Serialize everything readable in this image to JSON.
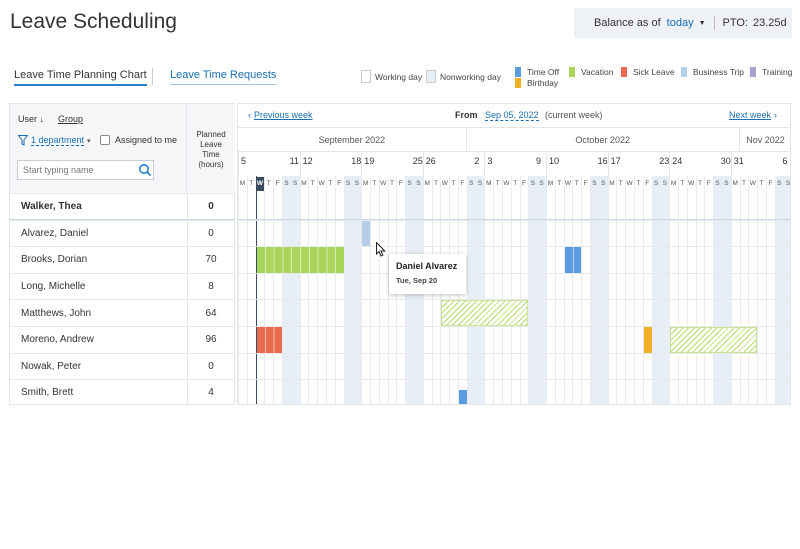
{
  "app": {
    "title": "Leave Scheduling"
  },
  "balance": {
    "label": "Balance as of",
    "date_option": "today",
    "pto_label": "PTO:",
    "pto_value": "23.25d"
  },
  "tabs": [
    {
      "label": "Leave Time Planning Chart",
      "active": true
    },
    {
      "label": "Leave Time Requests",
      "active": false
    }
  ],
  "legend": {
    "working_day": "Working day",
    "nonworking_day": "Nonworking day",
    "types": [
      {
        "label": "Time Off",
        "color": "#5b9be0"
      },
      {
        "label": "Vacation",
        "color": "#a8d55a"
      },
      {
        "label": "Sick Leave",
        "color": "#ea6a4f"
      },
      {
        "label": "Business Trip",
        "color": "#b6cde9"
      },
      {
        "label": "Training",
        "color": "#a8a0cf"
      },
      {
        "label": "Birthday",
        "color": "#f0b02a"
      }
    ]
  },
  "filters": {
    "user_label": "User",
    "group_label": "Group",
    "department": "1 department",
    "assigned_label": "Assigned to me",
    "search_placeholder": "Start typing name"
  },
  "planned_header": [
    "Planned",
    "Leave",
    "Time",
    "(hours)"
  ],
  "users": [
    {
      "name": "Walker, Thea",
      "hours": "0",
      "current": true
    },
    {
      "name": "Alvarez, Daniel",
      "hours": "0"
    },
    {
      "name": "Brooks, Dorian",
      "hours": "70"
    },
    {
      "name": "Long, Michelle",
      "hours": "8"
    },
    {
      "name": "Matthews, John",
      "hours": "64"
    },
    {
      "name": "Moreno, Andrew",
      "hours": "96"
    },
    {
      "name": "Nowak, Peter",
      "hours": "0"
    },
    {
      "name": "Smith, Brett",
      "hours": "4"
    }
  ],
  "nav": {
    "prev": "Previous week",
    "from_label": "From",
    "from_date": "Sep 05, 2022",
    "from_note": "(current week)",
    "next": "Next week"
  },
  "calendar": {
    "months": [
      {
        "label": "September 2022",
        "days": 26
      },
      {
        "label": "October 2022",
        "days": 31
      },
      {
        "label": "Nov 2022",
        "days": 6
      }
    ],
    "week_numbers": [
      "5",
      "11",
      "12",
      "18",
      "19",
      "25",
      "26",
      "2",
      "3",
      "9",
      "10",
      "16",
      "17",
      "23",
      "24",
      "30",
      "31",
      "6"
    ],
    "day_letters": [
      "M",
      "T",
      "W",
      "T",
      "F",
      "S",
      "S"
    ],
    "leave": [
      {
        "user": 1,
        "type": "Business Trip",
        "start": 14,
        "days": 1
      },
      {
        "user": 2,
        "type": "Vacation",
        "start": 2,
        "days": 10
      },
      {
        "user": 2,
        "type": "Time Off",
        "start": 37,
        "days": 2
      },
      {
        "user": 4,
        "type": "Vacation",
        "start": 23,
        "days": 10,
        "planned": true
      },
      {
        "user": 5,
        "type": "Sick Leave",
        "start": 2,
        "days": 3
      },
      {
        "user": 5,
        "type": "Birthday",
        "start": 46,
        "days": 1
      },
      {
        "user": 5,
        "type": "Vacation",
        "start": 49,
        "days": 10,
        "planned": true
      },
      {
        "user": 7,
        "type": "Time Off",
        "start": 25,
        "days": 1
      }
    ]
  },
  "tooltip": {
    "name": "Daniel Alvarez",
    "date": "Tue, Sep 20"
  }
}
